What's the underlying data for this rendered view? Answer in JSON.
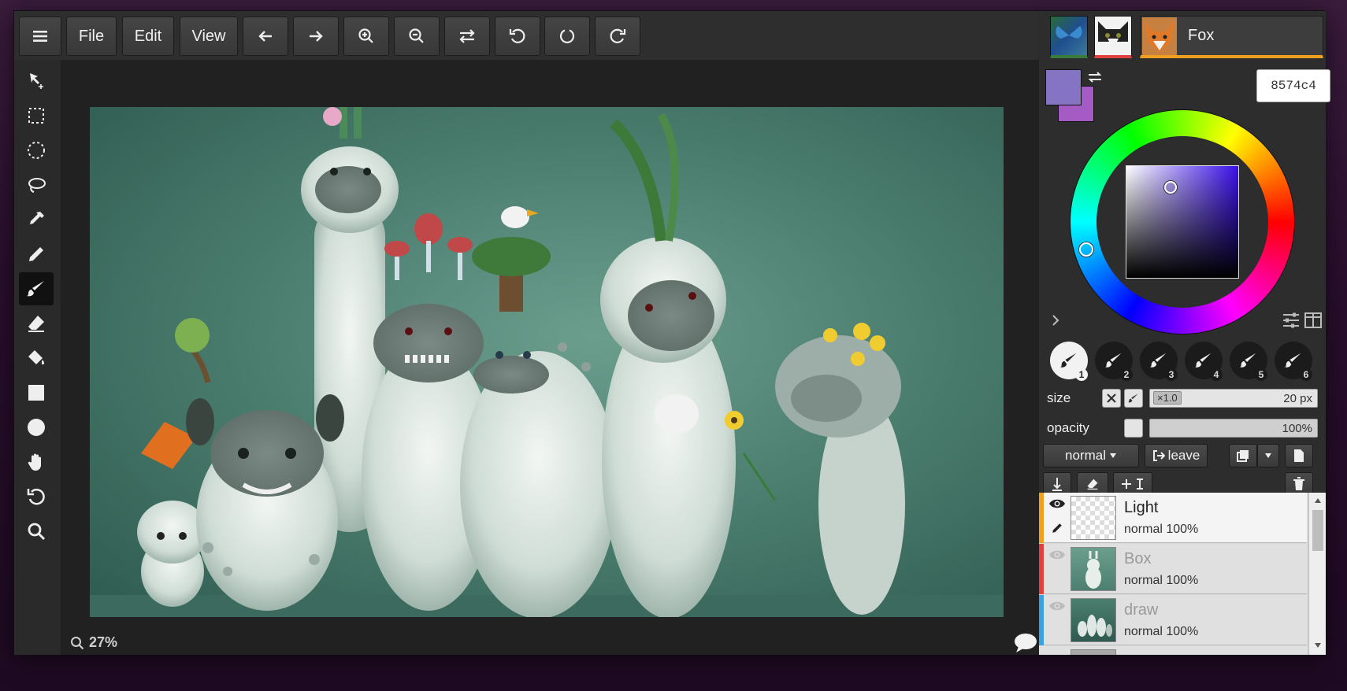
{
  "toolbar": {
    "menu_icon": "hamburger-icon",
    "file_label": "File",
    "edit_label": "Edit",
    "view_label": "View",
    "icons": [
      "undo-arrow-icon",
      "redo-arrow-icon",
      "zoom-in-icon",
      "zoom-out-icon",
      "flip-horizontal-icon",
      "rotate-left-icon",
      "reset-rotation-icon",
      "rotate-right-icon"
    ]
  },
  "tools": [
    {
      "name": "move-tool",
      "icon": "move-arrow-icon"
    },
    {
      "name": "rect-select-tool",
      "icon": "dashed-rect-icon"
    },
    {
      "name": "ellipse-select-tool",
      "icon": "dashed-ellipse-icon"
    },
    {
      "name": "lasso-tool",
      "icon": "lasso-icon"
    },
    {
      "name": "eyedropper-tool",
      "icon": "eyedropper-icon"
    },
    {
      "name": "pen-tool",
      "icon": "pencil-icon"
    },
    {
      "name": "brush-tool",
      "icon": "brush-icon",
      "active": true
    },
    {
      "name": "eraser-tool",
      "icon": "eraser-icon"
    },
    {
      "name": "fill-tool",
      "icon": "paint-bucket-icon"
    },
    {
      "name": "rectangle-tool",
      "icon": "square-icon"
    },
    {
      "name": "ellipse-tool",
      "icon": "circle-icon"
    },
    {
      "name": "hand-tool",
      "icon": "hand-icon"
    },
    {
      "name": "rotate-tool",
      "icon": "rotate-icon"
    },
    {
      "name": "zoom-tool",
      "icon": "magnifier-icon"
    }
  ],
  "canvas": {
    "zoom_text": "27%"
  },
  "users": {
    "active_name": "Fox",
    "active_tab_color": "#f0a020"
  },
  "color": {
    "primary": "#8574c4",
    "secondary": "#a45bc4",
    "hex_value": "8574c4"
  },
  "brushes": {
    "slots": [
      "1",
      "2",
      "3",
      "4",
      "5",
      "6"
    ],
    "active_slot": "1"
  },
  "props": {
    "size_label": "size",
    "size_multiplier": "×1.0",
    "size_value": "20 px",
    "opacity_label": "opacity",
    "opacity_value": "100%",
    "blend_mode": "normal",
    "leave_label": "leave"
  },
  "layers": [
    {
      "name": "Light",
      "mode": "normal",
      "opacity": "100%",
      "color": "#f0a020",
      "visible": true
    },
    {
      "name": "Box",
      "mode": "normal",
      "opacity": "100%",
      "color": "#e04040",
      "visible": false
    },
    {
      "name": "draw",
      "mode": "normal",
      "opacity": "100%",
      "color": "#3aa0e0",
      "visible": false
    }
  ]
}
